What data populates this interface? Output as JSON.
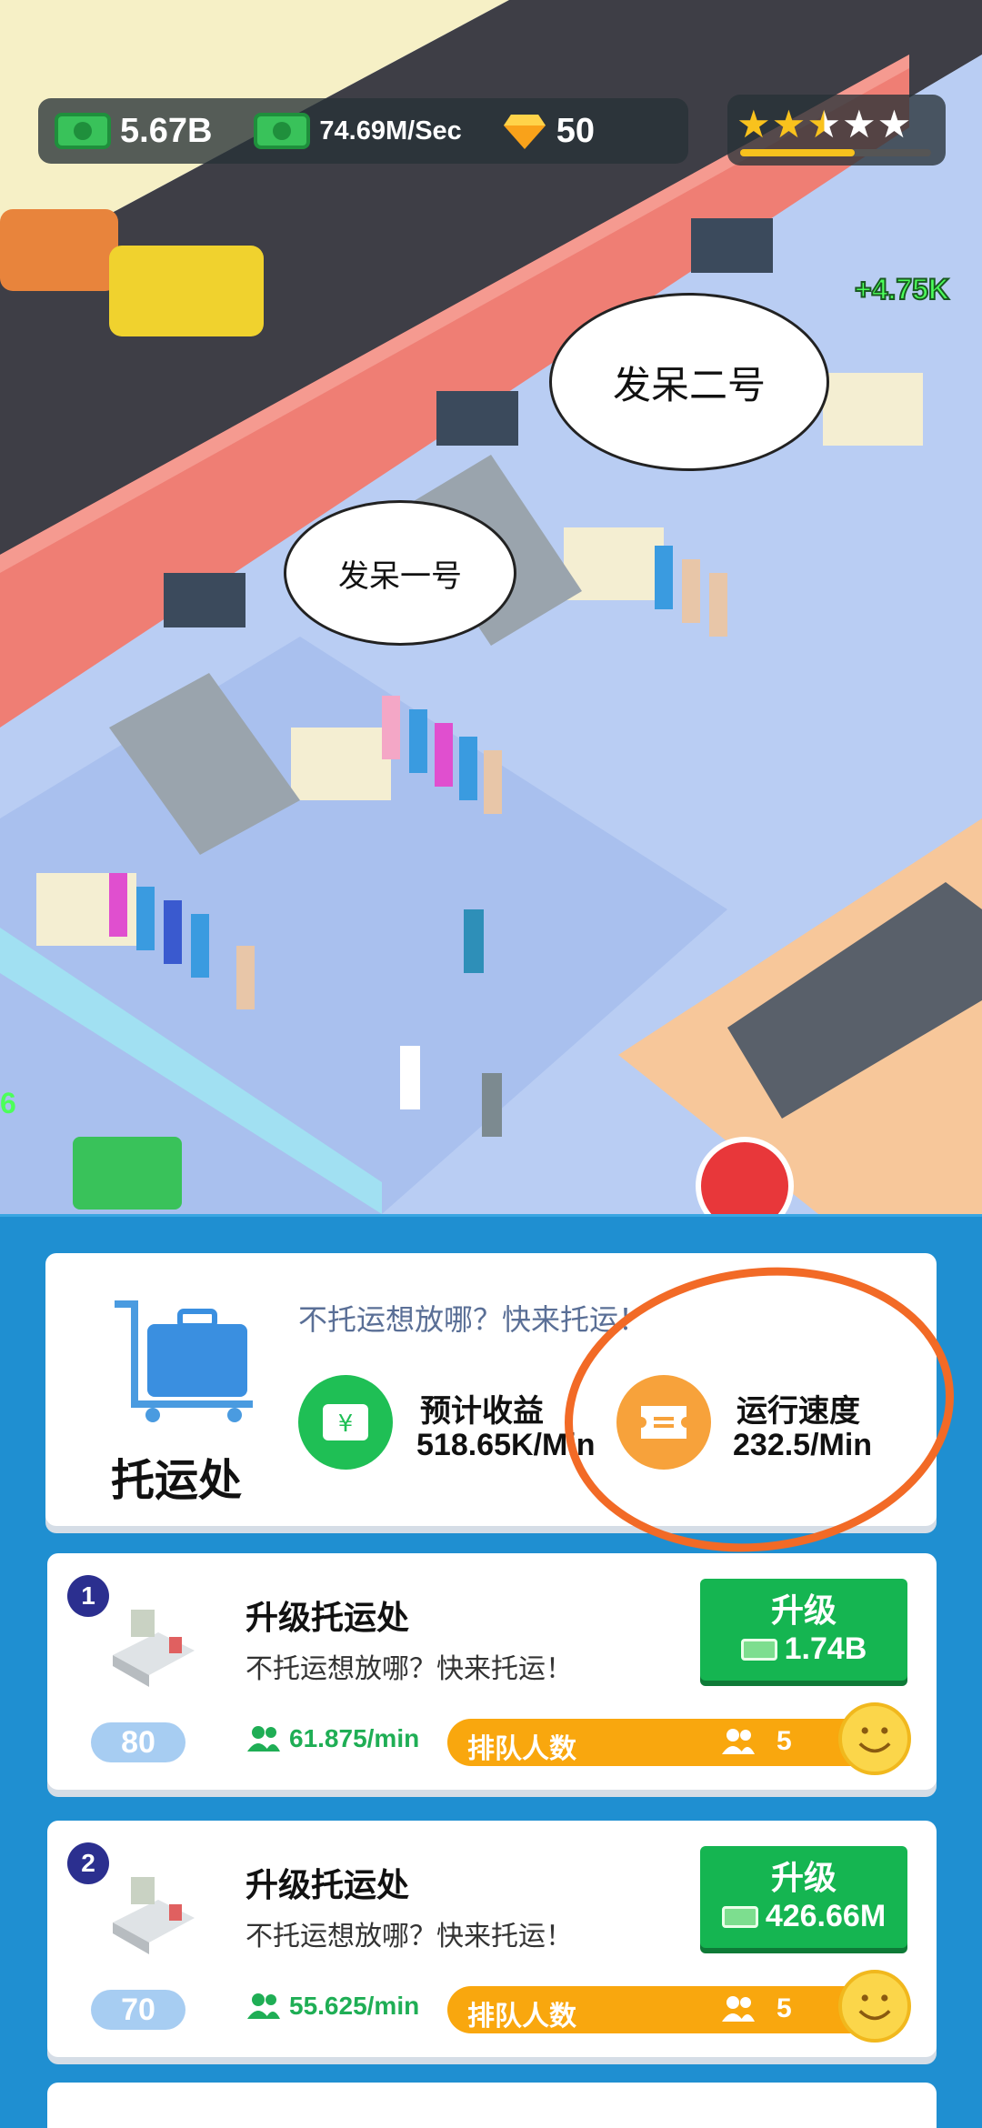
{
  "hud": {
    "cash": "5.67B",
    "rate": "74.69M/Sec",
    "gems": "50",
    "stars_filled": 2.5,
    "stars_total": 5,
    "star_progress": 0.6
  },
  "scene": {
    "income_popup": "+4.75K",
    "side_number": "6",
    "bubble_1": "发呆一号",
    "bubble_2": "发呆二号"
  },
  "station": {
    "title": "托运处",
    "description": "不托运想放哪？快来托运！",
    "income_label": "预计收益",
    "income_value": "518.65K/Min",
    "speed_label": "运行速度",
    "speed_value": "232.5/Min",
    "income_icon": "yen-icon",
    "speed_icon": "ticket-icon"
  },
  "upgrades": [
    {
      "index": "1",
      "title": "升级托运处",
      "description": "不托运想放哪？快来托运！",
      "button_label": "升级",
      "cost": "1.74B",
      "level": "80",
      "rate": "61.875/min",
      "queue_label": "排队人数",
      "queue_count": "5"
    },
    {
      "index": "2",
      "title": "升级托运处",
      "description": "不托运想放哪？快来托运！",
      "button_label": "升级",
      "cost": "426.66M",
      "level": "70",
      "rate": "55.625/min",
      "queue_label": "排队人数",
      "queue_count": "5"
    }
  ],
  "colors": {
    "panel_bg": "#1f8fd1",
    "green_button": "#15b551",
    "queue_orange": "#f9a70e",
    "annotation": "#f26a26"
  }
}
